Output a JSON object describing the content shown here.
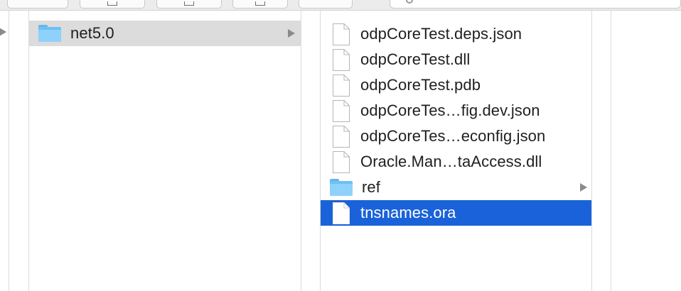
{
  "toolbar": {
    "buttons": [
      "view-button",
      "group-button",
      "share-button",
      "tags-button"
    ],
    "search_placeholder": ""
  },
  "columns": {
    "col2": {
      "items": [
        {
          "label": "net5.0",
          "kind": "folder",
          "selected": true,
          "has_children": true
        }
      ]
    },
    "col3": {
      "items": [
        {
          "label": "odpCoreTest.deps.json",
          "kind": "file"
        },
        {
          "label": "odpCoreTest.dll",
          "kind": "file"
        },
        {
          "label": "odpCoreTest.pdb",
          "kind": "file"
        },
        {
          "label": "odpCoreTes…fig.dev.json",
          "kind": "file"
        },
        {
          "label": "odpCoreTes…econfig.json",
          "kind": "file"
        },
        {
          "label": "Oracle.Man…taAccess.dll",
          "kind": "file"
        },
        {
          "label": "ref",
          "kind": "folder",
          "has_children": true
        },
        {
          "label": "tnsnames.ora",
          "kind": "file",
          "selected": true
        }
      ]
    }
  },
  "colors": {
    "selection_blue": "#1a62d9",
    "selection_gray": "#dcdcdc",
    "folder_blue": "#6cc0f5"
  }
}
